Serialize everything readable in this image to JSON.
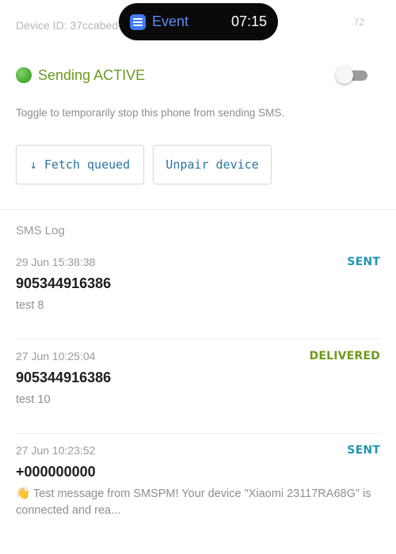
{
  "device": {
    "id_label": "Device ID: 37ccabed-",
    "count": "72"
  },
  "notification_pill": {
    "icon": "event-list-icon",
    "label": "Event",
    "time": "07:15",
    "icon_color": "#3f7bf5"
  },
  "sending": {
    "status_icon": "green-circle-icon",
    "status_text": "Sending ACTIVE",
    "toggle_on": false,
    "hint": "Toggle to temporarily stop this phone from sending SMS."
  },
  "actions": {
    "fetch_label": "↓ Fetch queued",
    "unpair_label": "Unpair device"
  },
  "sms_log": {
    "title": "SMS Log",
    "entries": [
      {
        "time": "29 Jun 15:38:38",
        "status": "SENT",
        "phone": "905344916386",
        "message": "test 8"
      },
      {
        "time": "27 Jun 10:25:04",
        "status": "DELIVERED",
        "phone": "905344916386",
        "message": "test 10"
      },
      {
        "time": "27 Jun 10:23:52",
        "status": "SENT",
        "phone": "+000000000",
        "message": "👋 Test message from SMSPM! Your device \"Xiaomi 23117RA68G\" is connected and rea..."
      }
    ]
  },
  "colors": {
    "active_green": "#6a9a1f",
    "sent_blue": "#1f96b3",
    "delivered_green": "#6e9a1c",
    "button_text": "#2b73a3"
  }
}
